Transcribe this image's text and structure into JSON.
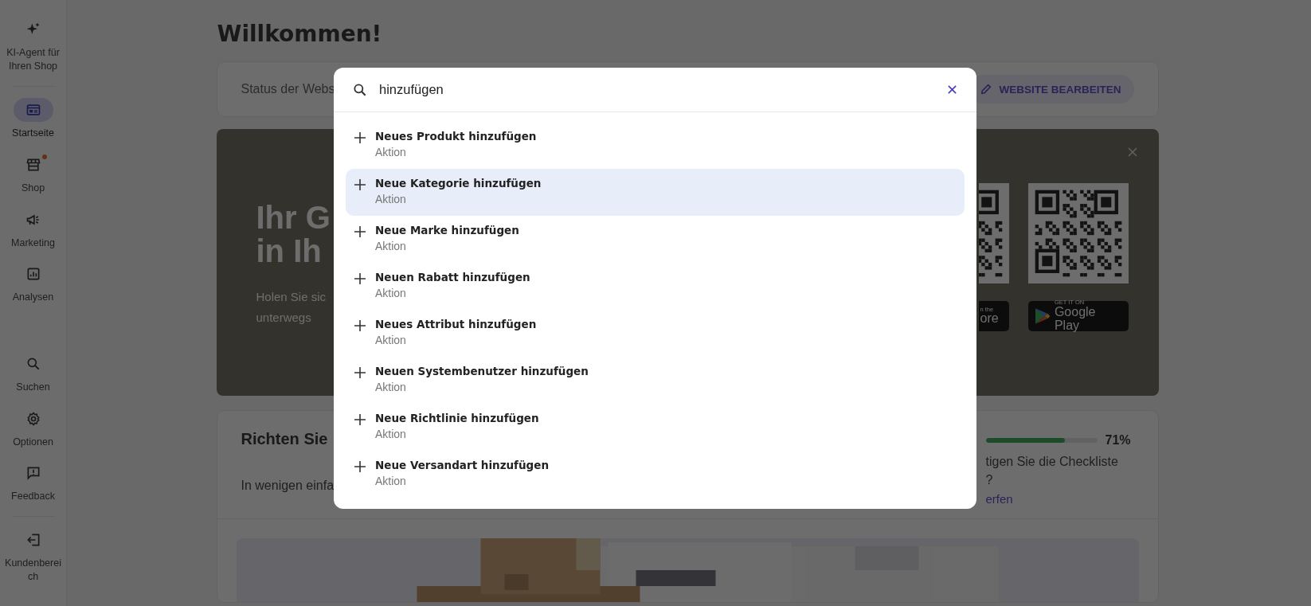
{
  "sidebar": {
    "top_items": [
      {
        "label": "KI-Agent für Ihren Shop",
        "selected": false,
        "badge": false
      },
      {
        "label": "Startseite",
        "selected": true,
        "badge": false
      },
      {
        "label": "Shop",
        "selected": false,
        "badge": true
      },
      {
        "label": "Marketing",
        "selected": false,
        "badge": false
      },
      {
        "label": "Analysen",
        "selected": false,
        "badge": false
      }
    ],
    "bottom_items": [
      {
        "label": "Suchen",
        "selected": false
      },
      {
        "label": "Optionen",
        "selected": false
      },
      {
        "label": "Feedback",
        "selected": false
      },
      {
        "label": "Kundenbereich",
        "selected": false
      }
    ]
  },
  "page": {
    "title": "Willkommen!"
  },
  "status_card": {
    "label": "Status der Webs",
    "button": "WEBSITE BEARBEITEN"
  },
  "banner": {
    "heading_lines": [
      "Ihr G",
      "in Ih"
    ],
    "text_lines": [
      "Holen Sie sic",
      "unterwegs"
    ],
    "store_badges": [
      {
        "small": "n the",
        "big": "ore"
      },
      {
        "small": "GET IT ON",
        "big": "Google Play"
      }
    ]
  },
  "checklist": {
    "title": "Richten Sie",
    "intro": "In wenigen einfa",
    "progress": {
      "level": 0.71,
      "reading": "71%"
    },
    "hint_lines": [
      "tigen Sie die Checkliste",
      "?"
    ],
    "link": "erfen"
  },
  "search": {
    "query": "hinzufügen",
    "results": [
      {
        "title": "Neues Produkt hinzufügen",
        "type": "Aktion",
        "selected": false
      },
      {
        "title": "Neue Kategorie hinzufügen",
        "type": "Aktion",
        "selected": true
      },
      {
        "title": "Neue Marke hinzufügen",
        "type": "Aktion",
        "selected": false
      },
      {
        "title": "Neuen Rabatt hinzufügen",
        "type": "Aktion",
        "selected": false
      },
      {
        "title": "Neues Attribut hinzufügen",
        "type": "Aktion",
        "selected": false
      },
      {
        "title": "Neuen Systembenutzer hinzufügen",
        "type": "Aktion",
        "selected": false
      },
      {
        "title": "Neue Richtlinie hinzufügen",
        "type": "Aktion",
        "selected": false
      },
      {
        "title": "Neue Versandart hinzufügen",
        "type": "Aktion",
        "selected": false
      }
    ]
  }
}
